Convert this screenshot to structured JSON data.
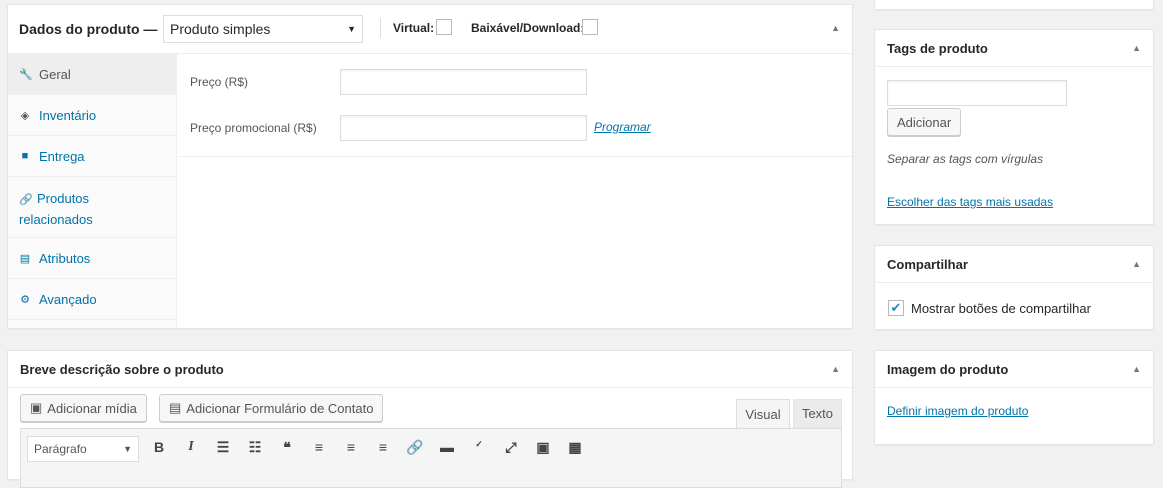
{
  "product_data": {
    "title": "Dados do produto —",
    "type_select": "Produto simples",
    "virtual_label": "Virtual:",
    "download_label": "Baixável/Download:",
    "tabs": [
      {
        "label": "Geral",
        "icon": "wrench-icon"
      },
      {
        "label": "Inventário",
        "icon": "tag-icon"
      },
      {
        "label": "Entrega",
        "icon": "truck-icon"
      },
      {
        "label": "Produtos relacionados",
        "icon": "link-icon"
      },
      {
        "label": "Atributos",
        "icon": "list-icon"
      },
      {
        "label": "Avançado",
        "icon": "gear-icon"
      }
    ],
    "price_label": "Preço (R$)",
    "price_value": "",
    "sale_price_label": "Preço promocional (R$)",
    "sale_price_value": "",
    "schedule_link": "Programar"
  },
  "short_desc": {
    "title": "Breve descrição sobre o produto",
    "add_media": "Adicionar mídia",
    "add_form": "Adicionar Formulário de Contato",
    "tab_visual": "Visual",
    "tab_text": "Texto",
    "format_select": "Parágrafo"
  },
  "tags": {
    "title": "Tags de produto",
    "input_value": "",
    "add_button": "Adicionar",
    "hint": "Separar as tags com vírgulas",
    "choose_link": "Escolher das tags mais usadas"
  },
  "share": {
    "title": "Compartilhar",
    "checkbox_label": "Mostrar botões de compartilhar",
    "checked": true
  },
  "image": {
    "title": "Imagem do produto",
    "set_link": "Definir imagem do produto"
  }
}
